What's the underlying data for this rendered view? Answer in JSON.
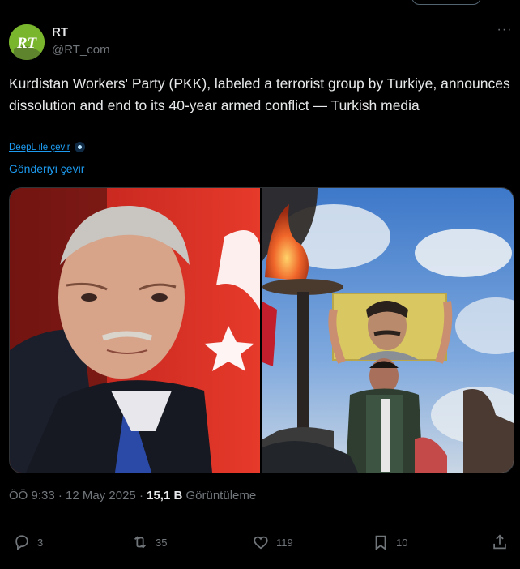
{
  "author": {
    "name": "RT",
    "handle": "@RT_com",
    "avatar_label": "RT"
  },
  "more_icon": "···",
  "tweet": {
    "text": "Kurdistan Workers' Party (PKK), labeled a terrorist group by Turkiye, announces dissolution and end to its 40-year armed conflict — Turkish media",
    "deepl_label": "DeepL ile çevir",
    "translate_label": "Gönderiyi çevir"
  },
  "meta": {
    "time": "ÖÖ 9:33",
    "separator": " · ",
    "date": "12 May 2025",
    "views_count": "15,1 B",
    "views_label": " Görüntüleme"
  },
  "actions": {
    "replies": "3",
    "reposts": "35",
    "likes": "119",
    "bookmarks": "10"
  },
  "icons": [
    "more-icon",
    "deepl-icon",
    "reply-icon",
    "repost-icon",
    "like-icon",
    "bookmark-icon",
    "share-icon"
  ],
  "colors": {
    "background": "#000000",
    "text": "#e7e9ea",
    "secondary": "#71767b",
    "link": "#1d9bf0",
    "border": "#2f3336",
    "avatar": "#7ab52e"
  }
}
